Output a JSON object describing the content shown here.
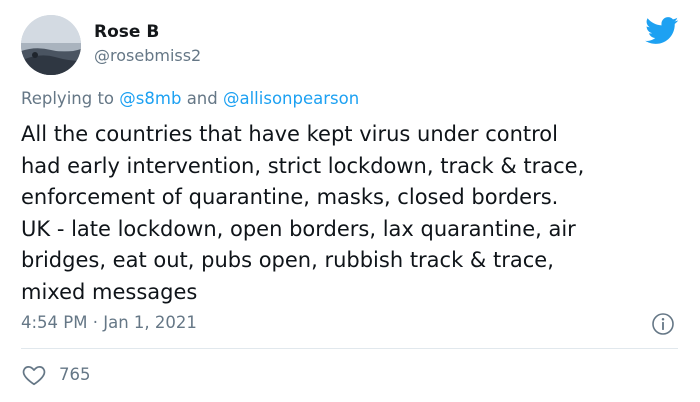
{
  "user": {
    "name": "Rose B",
    "handle": "@rosebmiss2"
  },
  "reply": {
    "prefix": "Replying to",
    "mention_1": "@s8mb",
    "conjunction": "and",
    "mention_2": "@allisonpearson"
  },
  "tweet": {
    "lines": [
      "All the countries that have kept virus under control",
      "had early intervention, strict lockdown, track & trace,",
      "enforcement of quarantine, masks, closed borders.",
      "UK - late lockdown, open borders, lax quarantine, air",
      "bridges, eat out, pubs open, rubbish track & trace,",
      "mixed messages"
    ],
    "timestamp": "4:54 PM · Jan 1, 2021"
  },
  "actions": {
    "like_count": "765"
  },
  "icons": {
    "brand": "twitter-bird-icon",
    "info": "info-icon",
    "like": "heart-icon"
  },
  "colors": {
    "brand_blue": "#1da1f2",
    "secondary_text": "#657786",
    "primary_text": "#0f1419",
    "divider": "#e1e8ed"
  }
}
